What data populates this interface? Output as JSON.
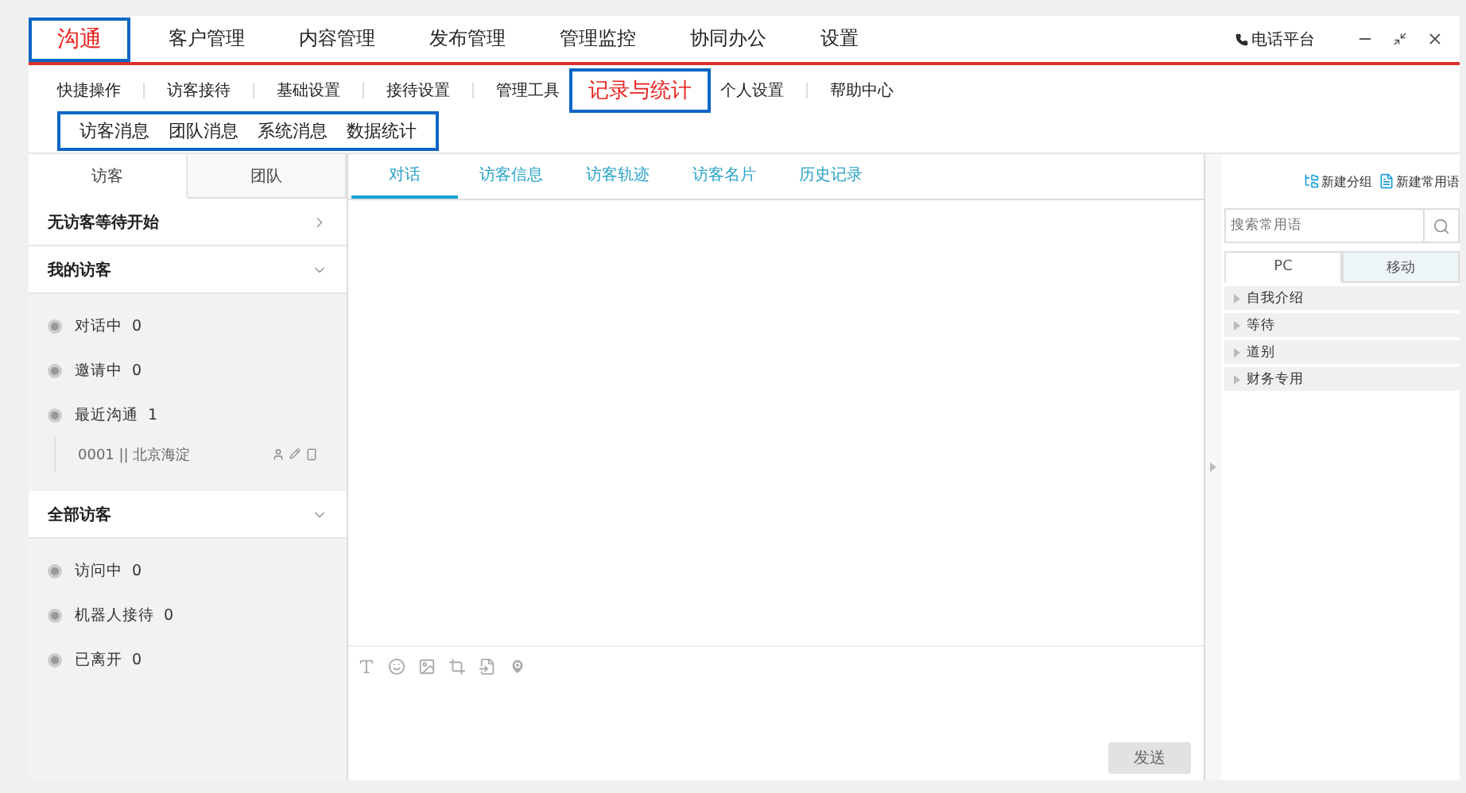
{
  "top_nav": [
    {
      "label": "沟通",
      "selected": true,
      "highlighted": true
    },
    {
      "label": "客户管理",
      "selected": false,
      "highlighted": false
    },
    {
      "label": "内容管理",
      "selected": false,
      "highlighted": false
    },
    {
      "label": "发布管理",
      "selected": false,
      "highlighted": false
    },
    {
      "label": "管理监控",
      "selected": false,
      "highlighted": false
    },
    {
      "label": "协同办公",
      "selected": false,
      "highlighted": false
    },
    {
      "label": "设置",
      "selected": false,
      "highlighted": false
    }
  ],
  "phone_platform": "电话平台",
  "sub_nav": [
    {
      "label": "快捷操作",
      "selected": false,
      "highlighted": false
    },
    {
      "label": "访客接待",
      "selected": false,
      "highlighted": false
    },
    {
      "label": "基础设置",
      "selected": false,
      "highlighted": false
    },
    {
      "label": "接待设置",
      "selected": false,
      "highlighted": false
    },
    {
      "label": "管理工具",
      "selected": false,
      "highlighted": false
    },
    {
      "label": "记录与统计",
      "selected": true,
      "highlighted": true
    },
    {
      "label": "个人设置",
      "selected": false,
      "highlighted": false
    },
    {
      "label": "帮助中心",
      "selected": false,
      "highlighted": false
    }
  ],
  "third_nav": {
    "highlighted": true,
    "items": [
      "访客消息",
      "团队消息",
      "系统消息",
      "数据统计"
    ]
  },
  "left_panel": {
    "tabs": [
      {
        "label": "访客",
        "selected": true
      },
      {
        "label": "团队",
        "selected": false
      }
    ],
    "sections": [
      {
        "title": "无访客等待开始",
        "expanded": false
      },
      {
        "title": "我的访客",
        "expanded": true,
        "items": [
          {
            "label": "对话中",
            "count": "0"
          },
          {
            "label": "邀请中",
            "count": "0"
          },
          {
            "label": "最近沟通",
            "count": "1",
            "visitors": [
              "0001 || 北京海淀"
            ]
          }
        ]
      },
      {
        "title": "全部访客",
        "expanded": true,
        "items": [
          {
            "label": "访问中",
            "count": "0"
          },
          {
            "label": "机器人接待",
            "count": "0"
          },
          {
            "label": "已离开",
            "count": "0"
          }
        ]
      }
    ]
  },
  "center": {
    "tabs": [
      {
        "label": "对话",
        "selected": true
      },
      {
        "label": "访客信息",
        "selected": false
      },
      {
        "label": "访客轨迹",
        "selected": false
      },
      {
        "label": "访客名片",
        "selected": false
      },
      {
        "label": "历史记录",
        "selected": false
      }
    ],
    "send_button": {
      "label": "发送",
      "disabled": true
    }
  },
  "right_panel": {
    "new_group": "新建分组",
    "new_phrase": "新建常用语",
    "search": {
      "placeholder": "搜索常用语"
    },
    "tabs": [
      {
        "label": "PC",
        "selected": true
      },
      {
        "label": "移动",
        "selected": false
      }
    ],
    "groups": [
      "自我介绍",
      "等待",
      "道别",
      "财务专用"
    ]
  }
}
